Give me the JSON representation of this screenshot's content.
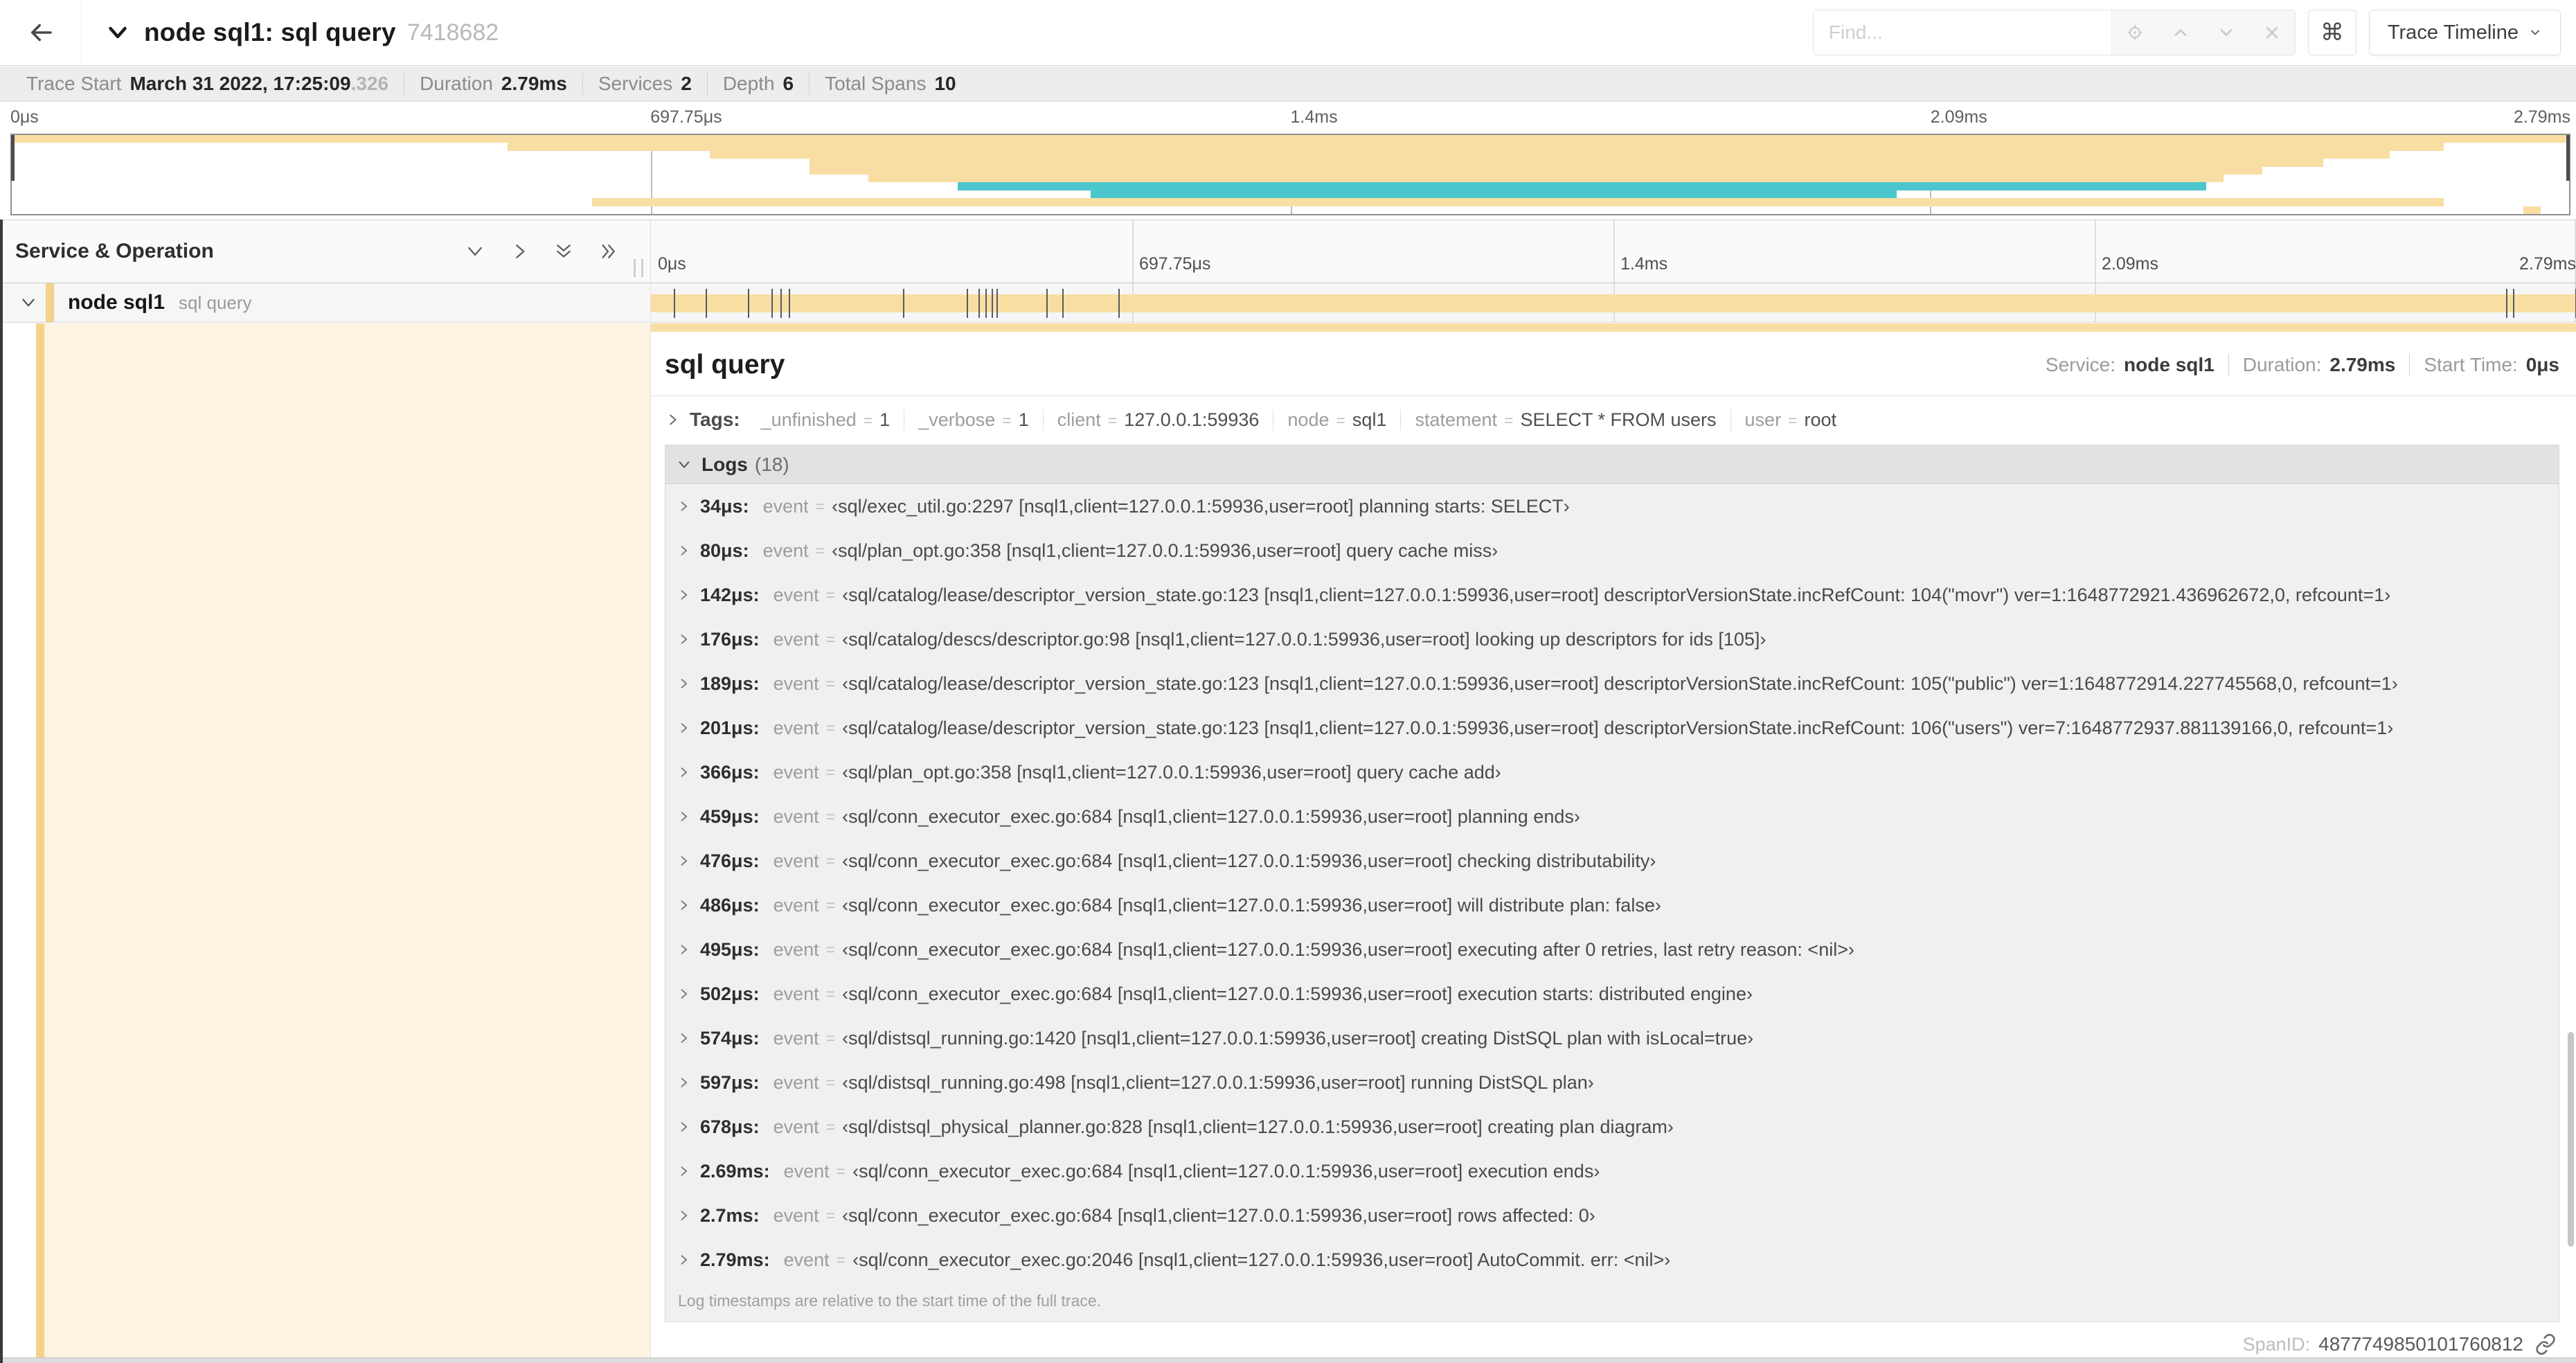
{
  "colors": {
    "tan": "#f8dea3",
    "teal": "#4bc6cc",
    "stripe": "#f3d28b",
    "cream": "#fcf3e1"
  },
  "topbar": {
    "title": "node sql1: sql query",
    "trace_id": "7418682",
    "find_placeholder": "Find...",
    "command_glyph": "⌘",
    "view_button_label": "Trace Timeline"
  },
  "stats": [
    {
      "label": "Trace Start",
      "value": "March 31 2022, 17:25:09",
      "muted": ".326"
    },
    {
      "label": "Duration",
      "value": "2.79ms"
    },
    {
      "label": "Services",
      "value": "2"
    },
    {
      "label": "Depth",
      "value": "6"
    },
    {
      "label": "Total Spans",
      "value": "10"
    }
  ],
  "minimap": {
    "ticks": [
      {
        "label": "0μs",
        "pct": 0,
        "align": "left"
      },
      {
        "label": "697.75μs",
        "pct": 25,
        "align": "left"
      },
      {
        "label": "1.4ms",
        "pct": 50,
        "align": "left"
      },
      {
        "label": "2.09ms",
        "pct": 75,
        "align": "left"
      },
      {
        "label": "2.79ms",
        "pct": 100,
        "align": "right"
      }
    ],
    "spans": [
      {
        "row": 0,
        "start_pct": 0,
        "end_pct": 100,
        "color": "tan"
      },
      {
        "row": 1,
        "start_pct": 19.4,
        "end_pct": 95.1,
        "color": "tan"
      },
      {
        "row": 2,
        "start_pct": 27.3,
        "end_pct": 93.0,
        "color": "tan"
      },
      {
        "row": 3,
        "start_pct": 31.2,
        "end_pct": 90.4,
        "color": "tan"
      },
      {
        "row": 4,
        "start_pct": 31.2,
        "end_pct": 88.0,
        "color": "tan"
      },
      {
        "row": 5,
        "start_pct": 33.5,
        "end_pct": 86.5,
        "color": "tan"
      },
      {
        "row": 6,
        "start_pct": 37.0,
        "end_pct": 85.8,
        "color": "teal"
      },
      {
        "row": 7,
        "start_pct": 42.2,
        "end_pct": 73.7,
        "color": "teal"
      },
      {
        "row": 8,
        "start_pct": 22.7,
        "end_pct": 95.1,
        "color": "tan"
      },
      {
        "row": 9,
        "start_pct": 98.2,
        "end_pct": 98.9,
        "color": "tan"
      }
    ]
  },
  "timeline": {
    "left_header": "Service & Operation",
    "ticks": [
      {
        "label": "0μs",
        "pct": 0,
        "align": "left"
      },
      {
        "label": "697.75μs",
        "pct": 25,
        "align": "left"
      },
      {
        "label": "1.4ms",
        "pct": 50,
        "align": "left"
      },
      {
        "label": "2.09ms",
        "pct": 75,
        "align": "left"
      },
      {
        "label": "2.79ms",
        "pct": 100,
        "align": "right"
      }
    ],
    "row": {
      "service": "node sql1",
      "operation": "sql query"
    },
    "bar": {
      "total_us": 2790,
      "tick_positions_us": [
        34,
        80,
        142,
        176,
        189,
        201,
        366,
        459,
        476,
        486,
        495,
        502,
        574,
        597,
        678,
        2690,
        2700,
        2790
      ]
    }
  },
  "detail": {
    "title": "sql query",
    "meta": [
      {
        "label": "Service:",
        "value": "node sql1"
      },
      {
        "label": "Duration:",
        "value": "2.79ms"
      },
      {
        "label": "Start Time:",
        "value": "0μs"
      }
    ],
    "tags_label": "Tags:",
    "tags": [
      {
        "key": "_unfinished",
        "value": "1"
      },
      {
        "key": "_verbose",
        "value": "1"
      },
      {
        "key": "client",
        "value": "127.0.0.1:59936"
      },
      {
        "key": "node",
        "value": "sql1"
      },
      {
        "key": "statement",
        "value": "SELECT * FROM users"
      },
      {
        "key": "user",
        "value": "root"
      }
    ],
    "logs_label": "Logs",
    "logs_count": "(18)",
    "logs": [
      {
        "time": "34μs",
        "key": "event",
        "value": "‹sql/exec_util.go:2297 [nsql1,client=127.0.0.1:59936,user=root] planning starts: SELECT›"
      },
      {
        "time": "80μs",
        "key": "event",
        "value": "‹sql/plan_opt.go:358 [nsql1,client=127.0.0.1:59936,user=root] query cache miss›"
      },
      {
        "time": "142μs",
        "key": "event",
        "value": "‹sql/catalog/lease/descriptor_version_state.go:123 [nsql1,client=127.0.0.1:59936,user=root] descriptorVersionState.incRefCount: 104(\"movr\") ver=1:1648772921.436962672,0, refcount=1›"
      },
      {
        "time": "176μs",
        "key": "event",
        "value": "‹sql/catalog/descs/descriptor.go:98 [nsql1,client=127.0.0.1:59936,user=root] looking up descriptors for ids [105]›"
      },
      {
        "time": "189μs",
        "key": "event",
        "value": "‹sql/catalog/lease/descriptor_version_state.go:123 [nsql1,client=127.0.0.1:59936,user=root] descriptorVersionState.incRefCount: 105(\"public\") ver=1:1648772914.227745568,0, refcount=1›"
      },
      {
        "time": "201μs",
        "key": "event",
        "value": "‹sql/catalog/lease/descriptor_version_state.go:123 [nsql1,client=127.0.0.1:59936,user=root] descriptorVersionState.incRefCount: 106(\"users\") ver=7:1648772937.881139166,0, refcount=1›"
      },
      {
        "time": "366μs",
        "key": "event",
        "value": "‹sql/plan_opt.go:358 [nsql1,client=127.0.0.1:59936,user=root] query cache add›"
      },
      {
        "time": "459μs",
        "key": "event",
        "value": "‹sql/conn_executor_exec.go:684 [nsql1,client=127.0.0.1:59936,user=root] planning ends›"
      },
      {
        "time": "476μs",
        "key": "event",
        "value": "‹sql/conn_executor_exec.go:684 [nsql1,client=127.0.0.1:59936,user=root] checking distributability›"
      },
      {
        "time": "486μs",
        "key": "event",
        "value": "‹sql/conn_executor_exec.go:684 [nsql1,client=127.0.0.1:59936,user=root] will distribute plan: false›"
      },
      {
        "time": "495μs",
        "key": "event",
        "value": "‹sql/conn_executor_exec.go:684 [nsql1,client=127.0.0.1:59936,user=root] executing after 0 retries, last retry reason: <nil>›"
      },
      {
        "time": "502μs",
        "key": "event",
        "value": "‹sql/conn_executor_exec.go:684 [nsql1,client=127.0.0.1:59936,user=root] execution starts: distributed engine›"
      },
      {
        "time": "574μs",
        "key": "event",
        "value": "‹sql/distsql_running.go:1420 [nsql1,client=127.0.0.1:59936,user=root] creating DistSQL plan with isLocal=true›"
      },
      {
        "time": "597μs",
        "key": "event",
        "value": "‹sql/distsql_running.go:498 [nsql1,client=127.0.0.1:59936,user=root] running DistSQL plan›"
      },
      {
        "time": "678μs",
        "key": "event",
        "value": "‹sql/distsql_physical_planner.go:828 [nsql1,client=127.0.0.1:59936,user=root] creating plan diagram›"
      },
      {
        "time": "2.69ms",
        "key": "event",
        "value": "‹sql/conn_executor_exec.go:684 [nsql1,client=127.0.0.1:59936,user=root] execution ends›"
      },
      {
        "time": "2.7ms",
        "key": "event",
        "value": "‹sql/conn_executor_exec.go:684 [nsql1,client=127.0.0.1:59936,user=root] rows affected: 0›"
      },
      {
        "time": "2.79ms",
        "key": "event",
        "value": "‹sql/conn_executor_exec.go:2046 [nsql1,client=127.0.0.1:59936,user=root] AutoCommit. err: <nil>›"
      }
    ],
    "logs_note": "Log timestamps are relative to the start time of the full trace.",
    "span_id_label": "SpanID:",
    "span_id": "4877749850101760812"
  }
}
